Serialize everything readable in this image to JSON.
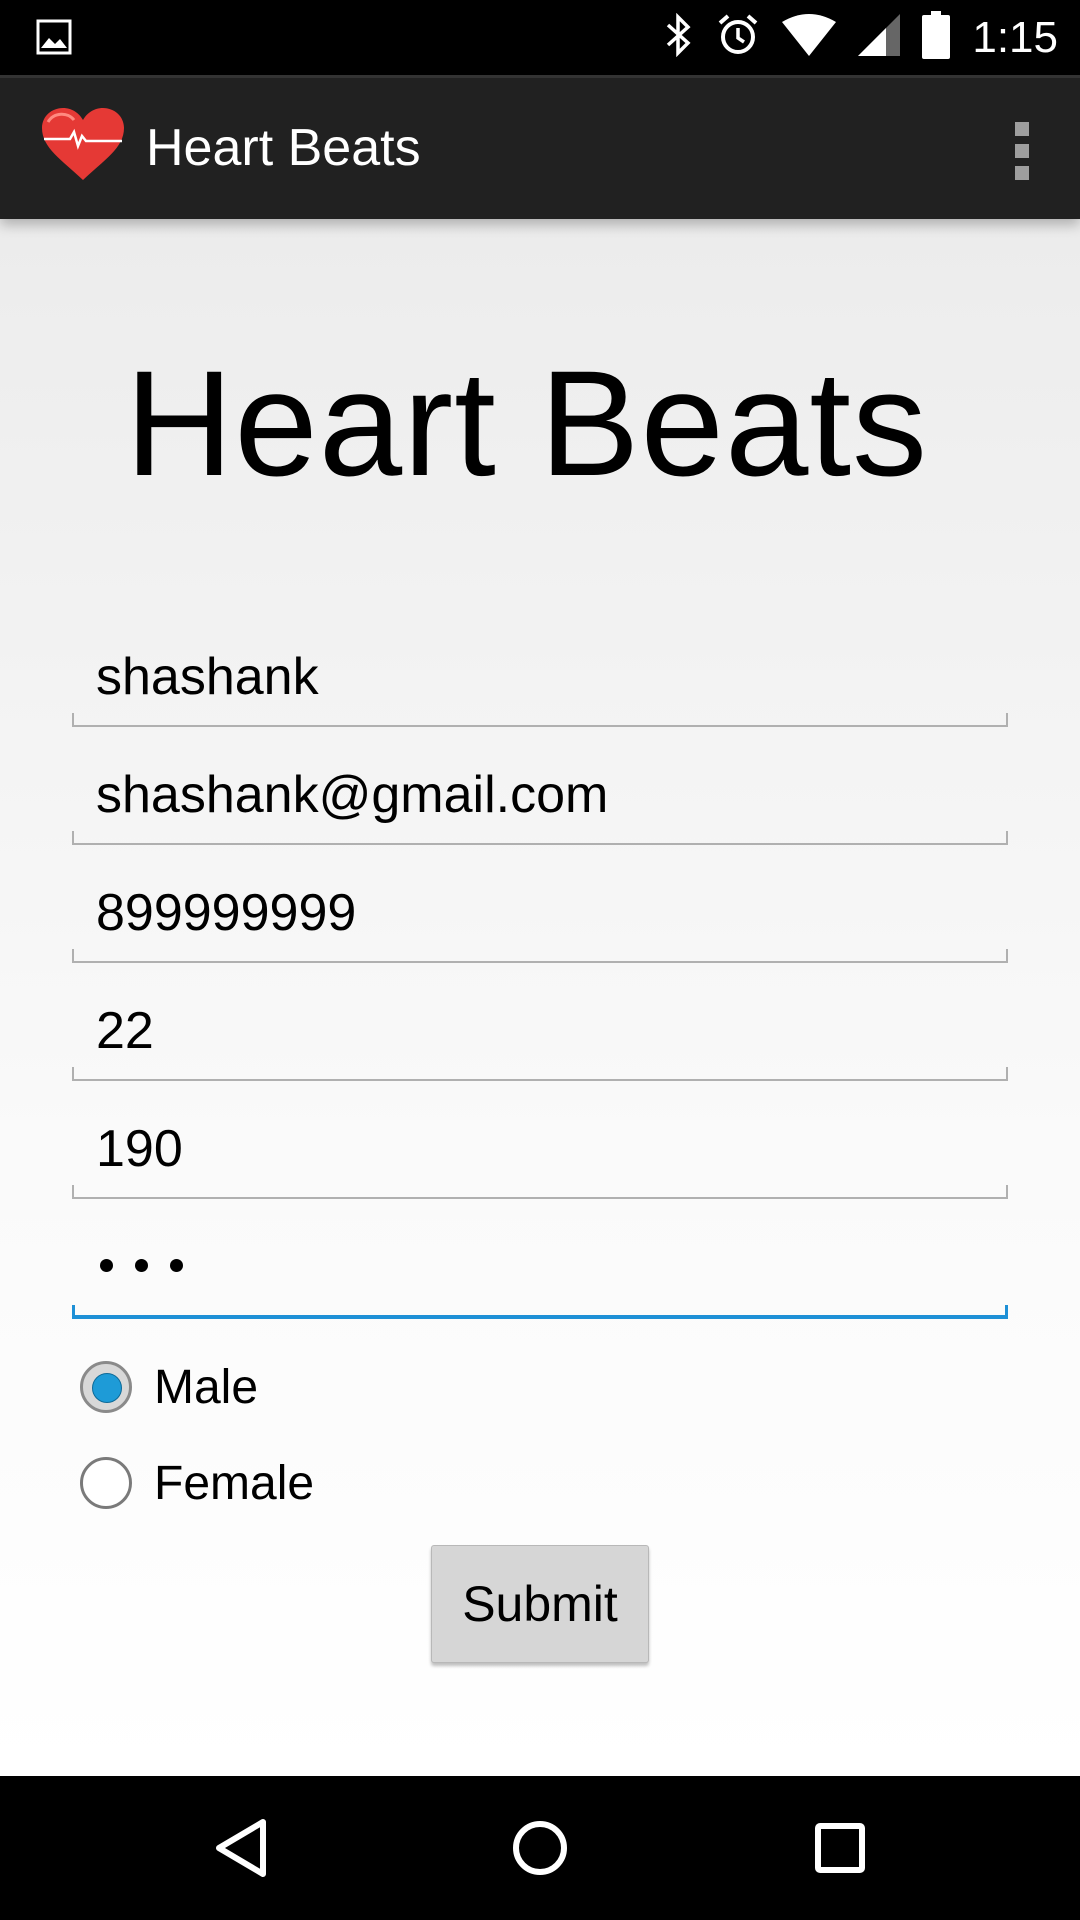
{
  "status_bar": {
    "time": "1:15",
    "icons": [
      "image-notification-icon",
      "bluetooth-icon",
      "alarm-icon",
      "wifi-icon",
      "signal-icon",
      "battery-icon"
    ]
  },
  "action_bar": {
    "title": "Heart Beats",
    "logo_icon": "heart-pulse-icon",
    "overflow_icon": "overflow-menu-icon"
  },
  "form": {
    "heading": "Heart Beats",
    "name_value": "shashank",
    "email_value": "shashank@gmail.com",
    "phone_value": "899999999",
    "age_value": "22",
    "height_value": "190",
    "password_mask_count": 3,
    "gender": {
      "options": [
        "Male",
        "Female"
      ],
      "selected": "Male"
    },
    "submit_label": "Submit"
  },
  "colors": {
    "accent": "#1e9bd7",
    "action_bar": "#212121",
    "logo_red": "#e53935"
  },
  "nav_bar": {
    "icons": [
      "back-icon",
      "home-icon",
      "recents-icon"
    ]
  }
}
